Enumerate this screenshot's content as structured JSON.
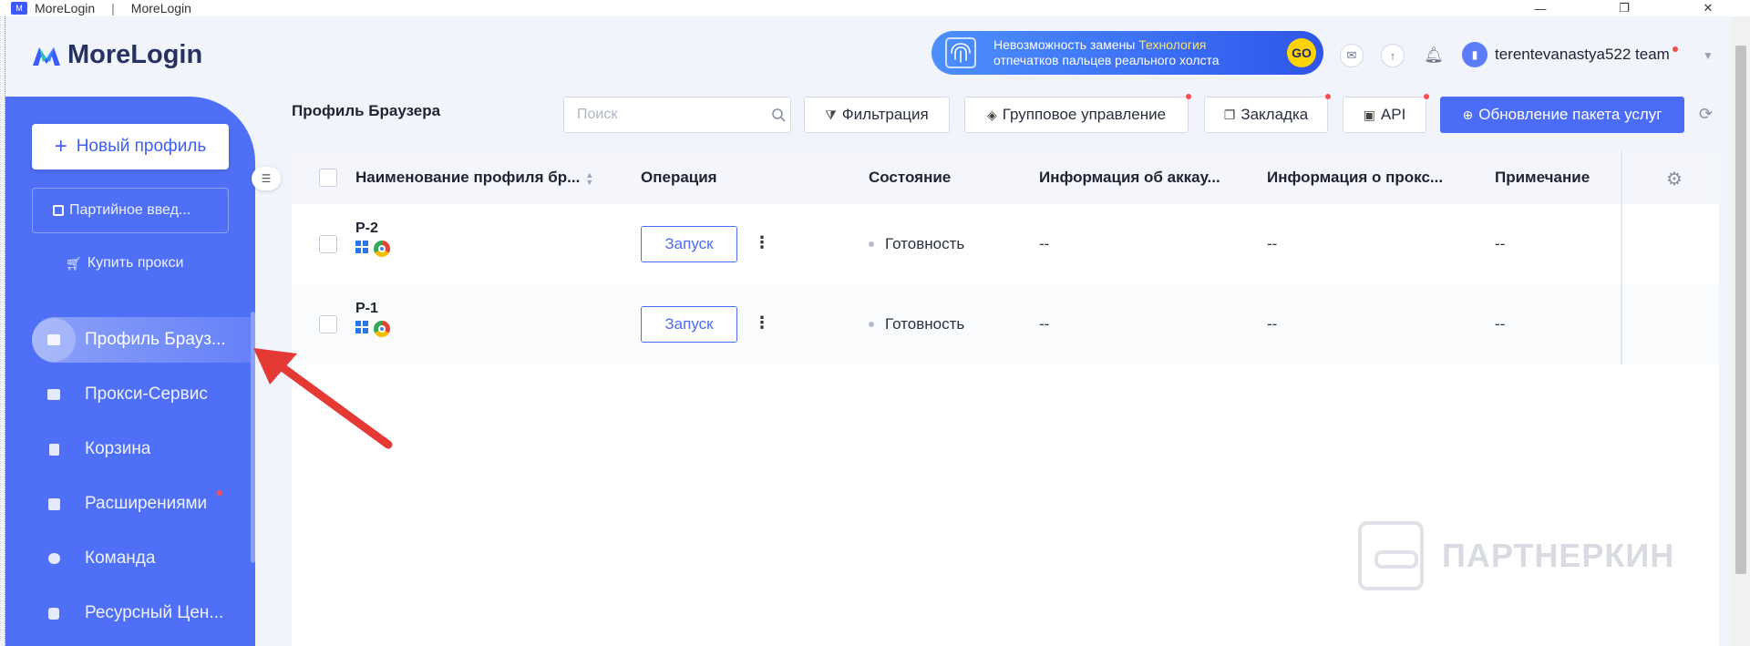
{
  "window": {
    "title": "MoreLogin",
    "title2": "MoreLogin",
    "separator": "|",
    "minimize": "—",
    "maximize": "❐",
    "close": "✕"
  },
  "header": {
    "logo_text": "MoreLogin",
    "banner": {
      "line1": "Невозможность замены",
      "line1_highlight": "Технология",
      "line2": "отпечатков пальцев реального холста",
      "go": "GO"
    },
    "user_name": "terentevanastya522 team"
  },
  "sidebar": {
    "new_profile": "Новый профиль",
    "batch_import": "Партийное введ...",
    "buy_proxy": "Купить прокси",
    "items": [
      {
        "label": "Профиль Брауз...",
        "active": true
      },
      {
        "label": "Прокси-Сервис",
        "active": false
      },
      {
        "label": "Корзина",
        "active": false
      },
      {
        "label": "Расширениями",
        "active": false,
        "dot": true
      },
      {
        "label": "Команда",
        "active": false
      },
      {
        "label": "Ресурсный Цен...",
        "active": false
      }
    ]
  },
  "main": {
    "title": "Профиль Браузера",
    "search_placeholder": "Поиск",
    "toolbar": {
      "filter": "Фильтрация",
      "group": "Групповое управление",
      "bookmark": "Закладка",
      "api": "API",
      "upgrade": "Обновление пакета услуг"
    },
    "table": {
      "columns": [
        "Наименование профиля бр...",
        "Операция",
        "Состояние",
        "Информация об аккау...",
        "Информация о прокс...",
        "Примечание"
      ],
      "rows": [
        {
          "name": "P-2",
          "launch": "Запуск",
          "status": "Готовность",
          "account": "--",
          "proxy": "--",
          "note": "--"
        },
        {
          "name": "P-1",
          "launch": "Запуск",
          "status": "Готовность",
          "account": "--",
          "proxy": "--",
          "note": "--"
        }
      ]
    }
  },
  "watermark": "ПАРТНЕРКИН",
  "colors": {
    "accent": "#4b6cf6",
    "sidebar": "#4f6ff6",
    "arrow": "#e53935"
  }
}
